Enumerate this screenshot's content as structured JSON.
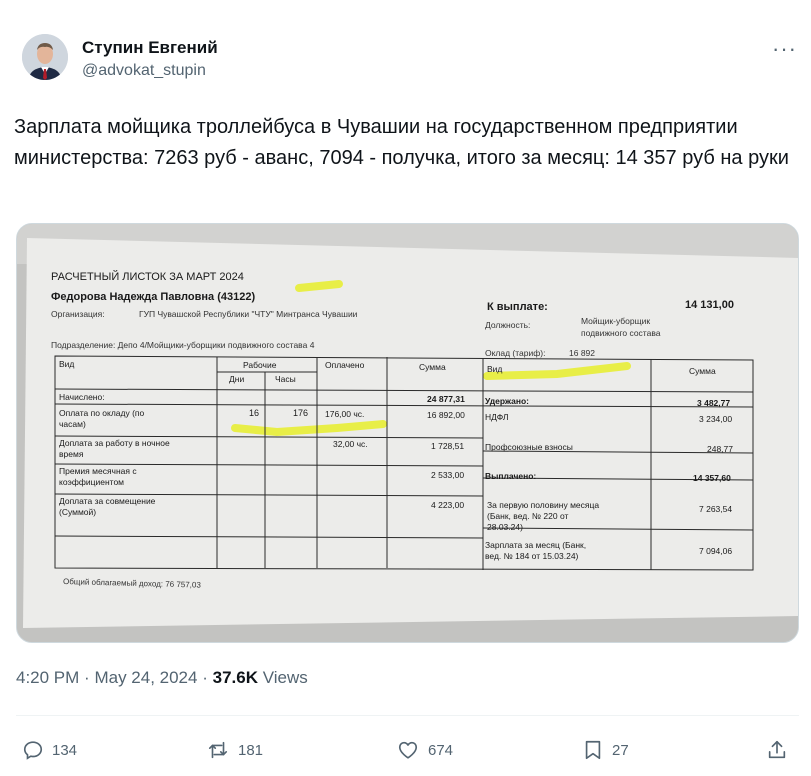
{
  "tweet": {
    "author_name": "Ступин Евгений",
    "author_handle": "@advokat_stupin",
    "more_label": "···",
    "text": "Зарплата мойщика троллейбуса в Чувашии на государственном предприятии министерства: 7263 руб - аванс, 7094 - получка, итого за месяц: 14 357 руб на руки",
    "time": "4:20 PM",
    "date": "May 24, 2024",
    "separator": "·",
    "views_count": "37.6K",
    "views_label": "Views"
  },
  "actions": {
    "replies": "134",
    "reposts": "181",
    "likes": "674",
    "bookmarks": "27"
  },
  "payslip": {
    "title": "РАСЧЕТНЫЙ ЛИСТОК ЗА МАРТ 2024",
    "employee": "Федорова Надежда Павловна (43122)",
    "org_label": "Организация:",
    "org_value": "ГУП Чувашской Республики \"ЧТУ\" Минтранса Чувашии",
    "dept": "Подразделение: Депо 4/Мойщики-уборщики подвижного состава 4",
    "pay_label": "К выплате:",
    "pay_value": "14 131,00",
    "position_label": "Должность:",
    "position_value_1": "Мойщик-уборщик",
    "position_value_2": "подвижного состава",
    "salary_label": "Оклад (тариф):",
    "salary_value": "16 892",
    "col_vid": "Вид",
    "col_worked": "Рабочие",
    "col_days": "Дни",
    "col_hours": "Часы",
    "col_paid": "Оплачено",
    "col_sum": "Сумма",
    "col_vid_right": "Вид",
    "col_sum_right": "Сумма",
    "accrued_label": "Начислено:",
    "accrued_total": "24 877,31",
    "withheld_label": "Удержано:",
    "withheld_total": "3 482,77",
    "row1_name_1": "Оплата по окладу (по",
    "row1_name_2": "часам)",
    "row1_days": "16",
    "row1_hours": "176",
    "row1_paid": "176,00 чс.",
    "row1_sum": "16 892,00",
    "ndfl_label": "НДФЛ",
    "ndfl_value": "3 234,00",
    "row2_name_1": "Доплата за работу в ночное",
    "row2_name_2": "время",
    "row2_paid": "32,00 чс.",
    "row2_sum": "1 728,51",
    "union_label": "Профсоюзные взносы",
    "union_value": "248,77",
    "row3_name_1": "Премия месячная с",
    "row3_name_2": "коэффициентом",
    "row3_sum": "2 533,00",
    "paid_out_label": "Выплачено:",
    "paid_out_total": "14 357,60",
    "row4_name_1": "Доплата за совмещение",
    "row4_name_2": "(Суммой)",
    "row4_sum": "4 223,00",
    "advance_1": "За первую половину месяца",
    "advance_2": "(Банк, вед. № 220 от",
    "advance_3": "28.03.24)",
    "advance_value": "7 263,54",
    "salary_month_1": "Зарплата за месяц (Банк,",
    "salary_month_2": "вед. № 184 от 15.03.24)",
    "salary_month_value": "7 094,06",
    "total_income": "Общий облагаемый доход: 76 757,03"
  },
  "colors": {
    "text": "#0f1419",
    "secondary": "#536471",
    "highlighter": "#e8ee2a",
    "paper": "#ebebeb"
  },
  "icons": [
    "avatar",
    "more-icon",
    "reply-icon",
    "repost-icon",
    "like-icon",
    "bookmark-icon",
    "share-icon"
  ]
}
